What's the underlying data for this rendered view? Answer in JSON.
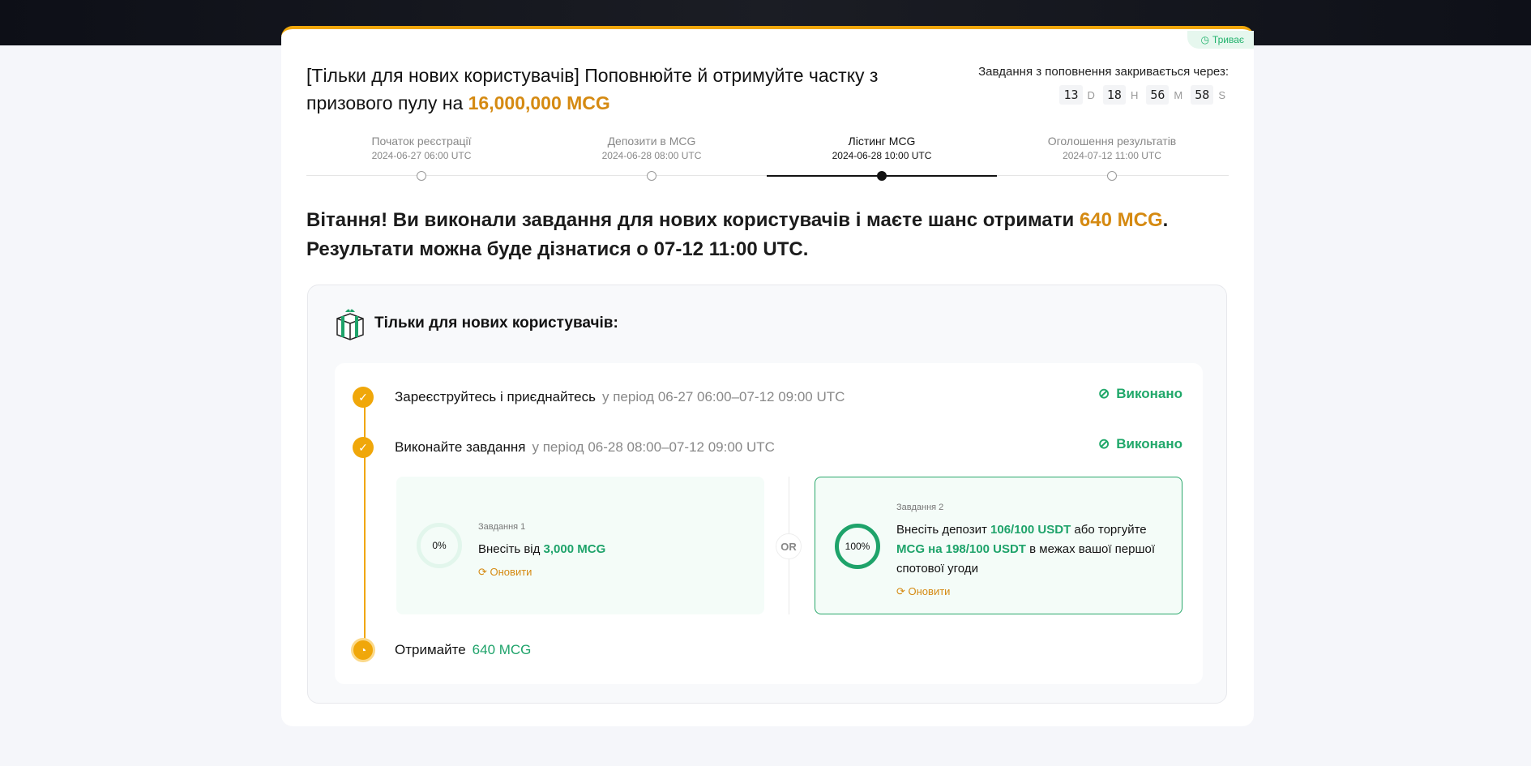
{
  "status_badge": "Триває",
  "title": {
    "prefix": "[Тільки для нових користувачів] Поповнюйте й отримуйте частку з призового пулу на ",
    "amount": "16,000,000 MCG"
  },
  "countdown": {
    "label": "Завдання з поповнення закривається через:",
    "days": "13",
    "d": "D",
    "hours": "18",
    "h": "H",
    "minutes": "56",
    "m": "M",
    "seconds": "58",
    "s": "S"
  },
  "timeline": [
    {
      "name": "Початок реєстрації",
      "date": "2024-06-27 06:00 UTC"
    },
    {
      "name": "Депозити в MCG",
      "date": "2024-06-28 08:00 UTC"
    },
    {
      "name": "Лістинг MCG",
      "date": "2024-06-28 10:00 UTC"
    },
    {
      "name": "Оголошення результатів",
      "date": "2024-07-12 11:00 UTC"
    }
  ],
  "congrats": {
    "part1": "Вітання! Ви виконали завдання для нових користувачів і маєте шанс отримати ",
    "amount": "640 MCG",
    "part2": ".",
    "line2": "Результати можна буде дізнатися о 07-12 11:00 UTC."
  },
  "section_title": "Тільки для нових користувачів:",
  "steps": [
    {
      "label": "Зареєструйтесь і приєднайтесь",
      "period": "у період 06-27 06:00–07-12 09:00 UTC",
      "status": "Виконано"
    },
    {
      "label": "Виконайте завдання",
      "period": "у період 06-28 08:00–07-12 09:00 UTC",
      "status": "Виконано"
    },
    {
      "label": "Отримайте",
      "reward": "640 MCG"
    }
  ],
  "task1": {
    "label": "Завдання 1",
    "progress": "0%",
    "text": "Внесіть від ",
    "amount": "3,000 MCG",
    "refresh": "Оновити"
  },
  "or": "OR",
  "task2": {
    "label": "Завдання 2",
    "progress": "100%",
    "t1": "Внесіть депозит ",
    "a1": "106/100 USDT",
    "t2": " або торгуйте ",
    "a2": "MCG на 198/100 USDT",
    "t3": " в межах вашої першої спотової угоди",
    "refresh": "Оновити"
  }
}
